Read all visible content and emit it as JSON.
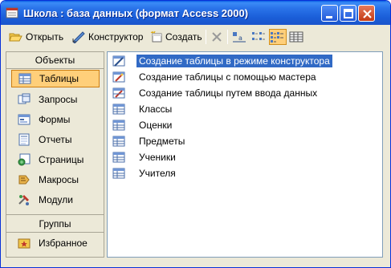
{
  "window": {
    "title": "Школа : база данных (формат Access 2000)"
  },
  "toolbar": {
    "open_label": "Открыть",
    "design_label": "Конструктор",
    "create_label": "Создать"
  },
  "objects_panel": {
    "header": "Объекты",
    "items": [
      {
        "label": "Таблицы",
        "icon": "tables-icon"
      },
      {
        "label": "Запросы",
        "icon": "queries-icon"
      },
      {
        "label": "Формы",
        "icon": "forms-icon"
      },
      {
        "label": "Отчеты",
        "icon": "reports-icon"
      },
      {
        "label": "Страницы",
        "icon": "pages-icon"
      },
      {
        "label": "Макросы",
        "icon": "macros-icon"
      },
      {
        "label": "Модули",
        "icon": "modules-icon"
      }
    ],
    "groups_header": "Группы",
    "groups": [
      {
        "label": "Избранное",
        "icon": "favorites-icon"
      }
    ]
  },
  "list": {
    "items": [
      {
        "label": "Создание таблицы в режиме конструктора",
        "icon": "design-wizard-icon"
      },
      {
        "label": "Создание таблицы с помощью мастера",
        "icon": "wizard-icon"
      },
      {
        "label": "Создание таблицы путем ввода данных",
        "icon": "datasheet-wizard-icon"
      },
      {
        "label": "Классы",
        "icon": "table-icon"
      },
      {
        "label": "Оценки",
        "icon": "table-icon"
      },
      {
        "label": "Предметы",
        "icon": "table-icon"
      },
      {
        "label": "Ученики",
        "icon": "table-icon"
      },
      {
        "label": "Учителя",
        "icon": "table-icon"
      }
    ]
  }
}
